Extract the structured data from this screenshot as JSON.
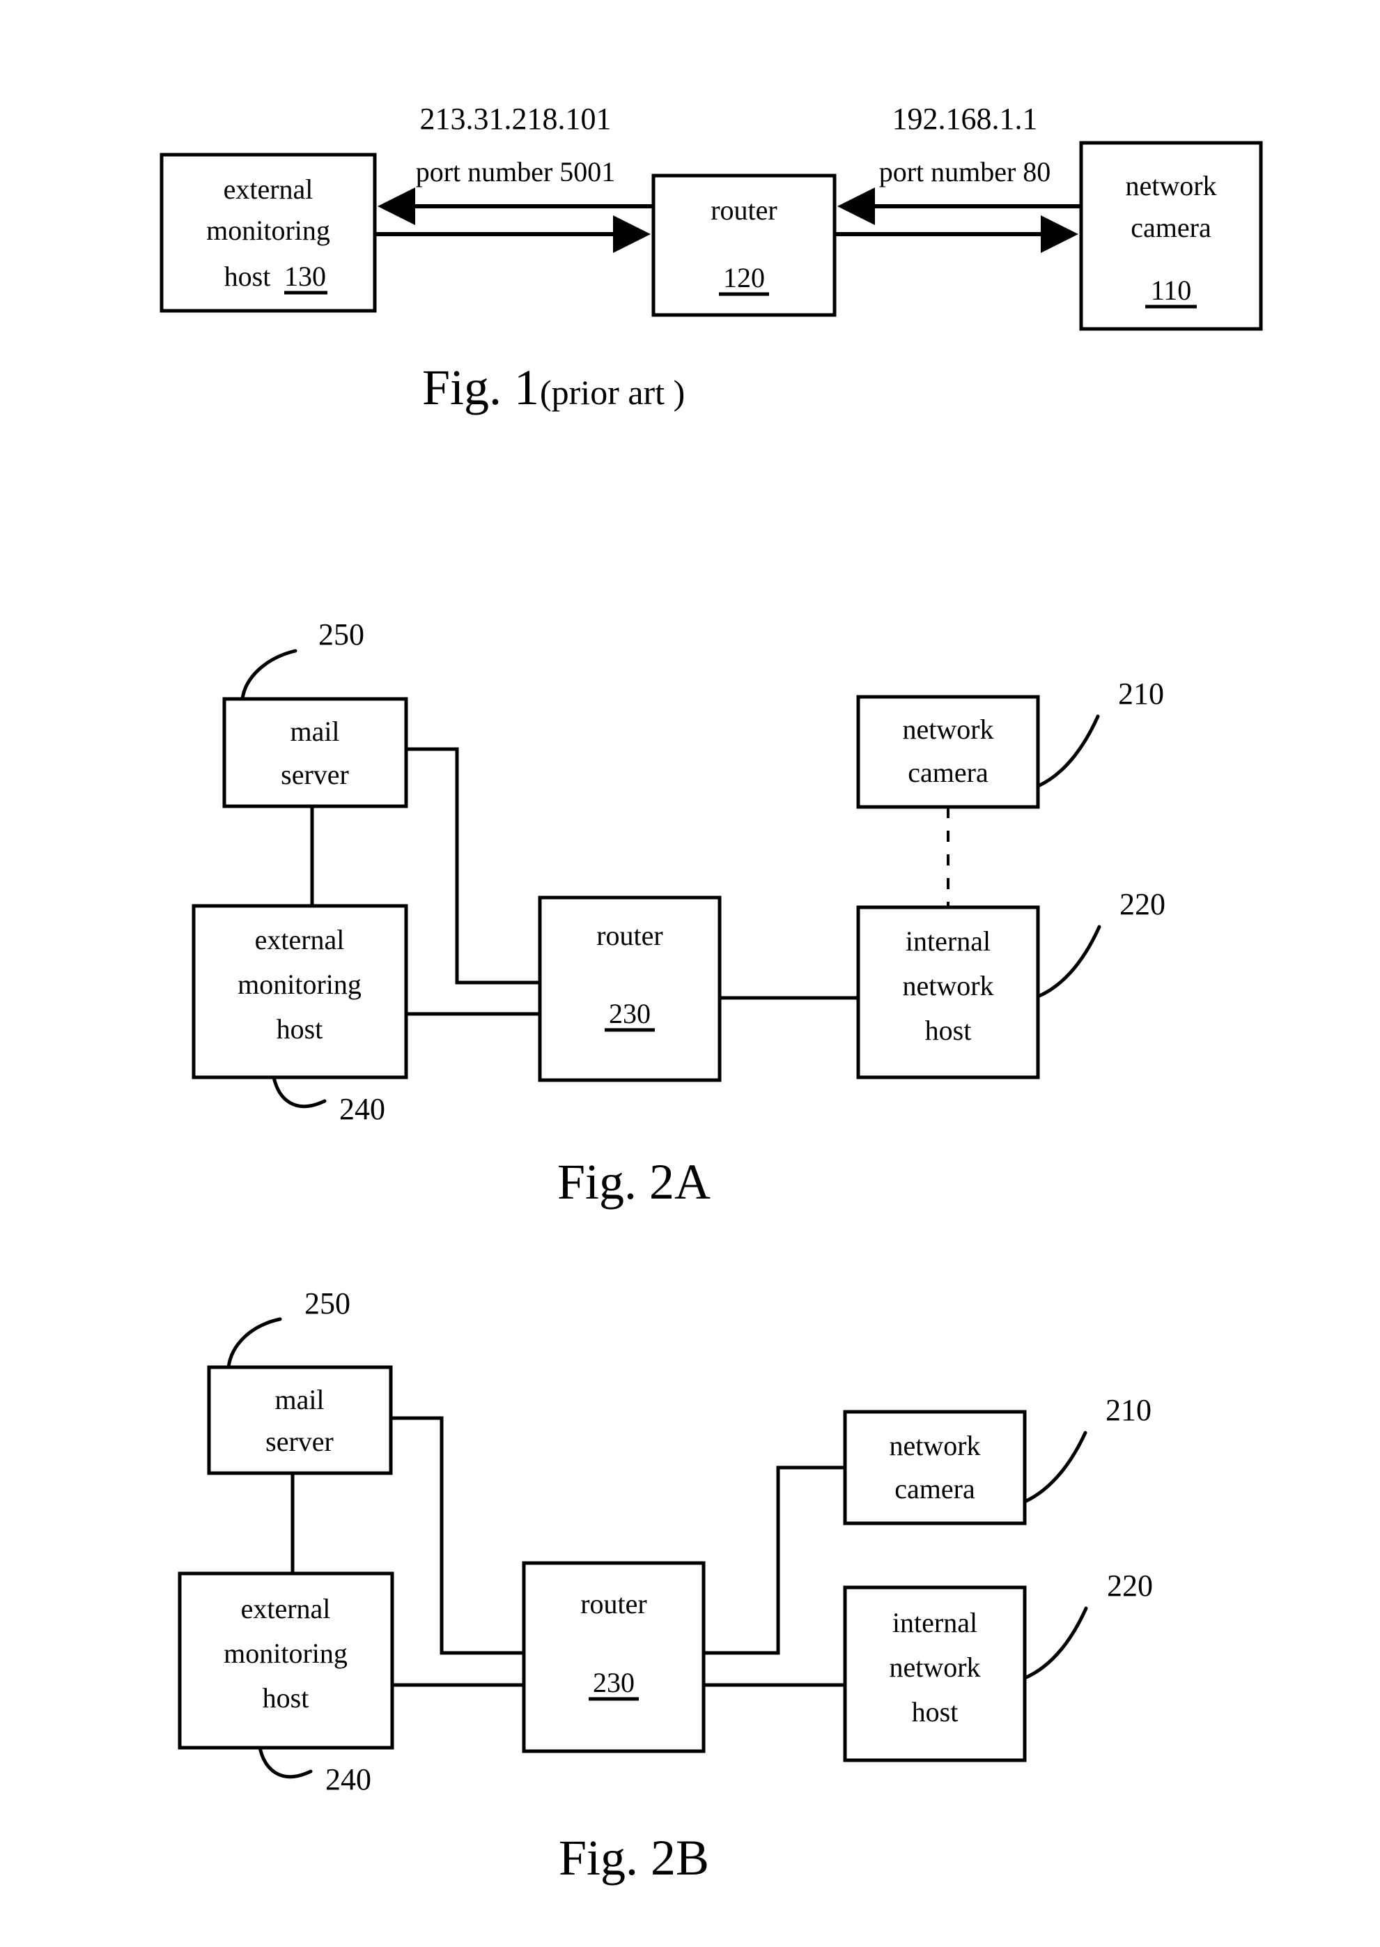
{
  "document": {
    "type": "patent-drawing-sheet",
    "figures": [
      "Fig. 1 (prior art )",
      "Fig. 2A",
      "Fig. 2B"
    ]
  },
  "fig1": {
    "caption_main": "Fig. 1",
    "caption_sub": "(prior art )",
    "nodes": {
      "external_host": {
        "line1": "external",
        "line2": "monitoring",
        "line3": "host",
        "ref": "130"
      },
      "router": {
        "line1": "router",
        "ref": "120"
      },
      "network_camera": {
        "line1": "network",
        "line2": "camera",
        "ref": "110"
      }
    },
    "links": {
      "left": {
        "address": "213.31.218.101",
        "port": "port number 5001"
      },
      "right": {
        "address": "192.168.1.1",
        "port": "port number 80"
      }
    }
  },
  "fig2a": {
    "caption_main": "Fig. 2A",
    "nodes": {
      "mail_server": {
        "line1": "mail",
        "line2": "server",
        "ref": "250"
      },
      "external_host": {
        "line1": "external",
        "line2": "monitoring",
        "line3": "host",
        "ref": "240"
      },
      "router": {
        "line1": "router",
        "ref": "230"
      },
      "network_camera": {
        "line1": "network",
        "line2": "camera",
        "ref": "210"
      },
      "internal_host": {
        "line1": "internal",
        "line2": "network",
        "line3": "host",
        "ref": "220"
      }
    }
  },
  "fig2b": {
    "caption_main": "Fig. 2B",
    "nodes": {
      "mail_server": {
        "line1": "mail",
        "line2": "server",
        "ref": "250"
      },
      "external_host": {
        "line1": "external",
        "line2": "monitoring",
        "line3": "host",
        "ref": "240"
      },
      "router": {
        "line1": "router",
        "ref": "230"
      },
      "network_camera": {
        "line1": "network",
        "line2": "camera",
        "ref": "210"
      },
      "internal_host": {
        "line1": "internal",
        "line2": "network",
        "line3": "host",
        "ref": "220"
      }
    }
  }
}
